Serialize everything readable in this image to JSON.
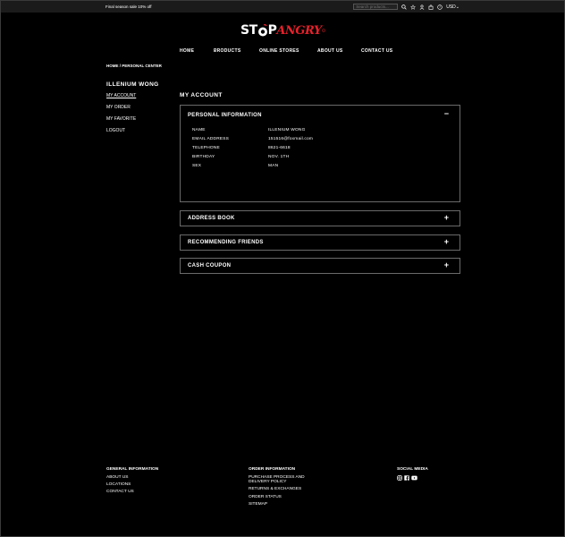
{
  "topbar": {
    "promo": "Final season sale 10% off",
    "search_placeholder": "Search products...",
    "currency": "USD"
  },
  "logo": {
    "part1": "ST",
    "part1b": "P",
    "part2": "ANGRY"
  },
  "nav": {
    "items": [
      "HOME",
      "PRODUCTS",
      "ONLINE STORES",
      "ABOUT US",
      "CONTACT US"
    ]
  },
  "breadcrumb": "HOME / PERSONAL CENTER",
  "sidebar": {
    "user_name": "ILLENIUM WONG",
    "links": [
      "MY ACCOUNT",
      "MY ORDER",
      "MY FAVORITE",
      "LOGOUT"
    ]
  },
  "main": {
    "title": "MY ACCOUNT",
    "personal_info": {
      "title": "PERSONAL INFORMATION",
      "toggle": "−",
      "fields": [
        {
          "label": "NAME",
          "value": "ILLENIUM WONG"
        },
        {
          "label": "EMAIL ADDRESS",
          "value": "151516@foxmail.com"
        },
        {
          "label": "TELEPHONE",
          "value": "8621-6618"
        },
        {
          "label": "BIRTHDAY",
          "value": "NOV. 1TH"
        },
        {
          "label": "SEX",
          "value": "MAN"
        }
      ]
    },
    "sections": [
      {
        "title": "ADDRESS BOOK",
        "toggle": "+"
      },
      {
        "title": "RECOMMENDING FRIENDS",
        "toggle": "+"
      },
      {
        "title": "CASH COUPON",
        "toggle": "+"
      }
    ]
  },
  "footer": {
    "general": {
      "heading": "GENERAL INFORMATION",
      "links": [
        "ABOUT US",
        "LOCATIONS",
        "CONTACT US"
      ]
    },
    "order": {
      "heading": "ORDER INFORMATION",
      "links": [
        "PURCHASE PROCESS AND",
        "DELIVERY POLICY",
        "RETURNS & EXCHANGES",
        "ORDER STATUS",
        "SITEMAP"
      ]
    },
    "social": {
      "heading": "SOCIAL MEDIA",
      "icons": [
        "instagram-icon",
        "facebook-icon",
        "youtube-icon"
      ]
    }
  },
  "colors": {
    "brand_red": "#e8202a",
    "background": "#000000",
    "border": "#6a6a6a"
  }
}
